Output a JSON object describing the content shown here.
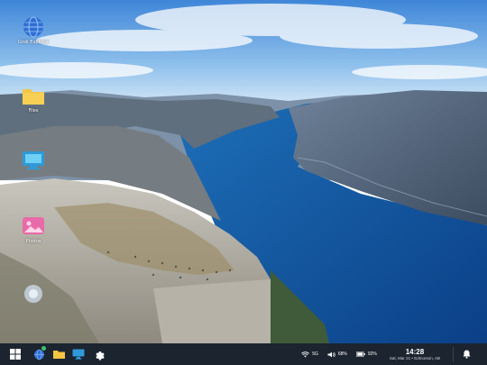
{
  "desktop": {
    "icons": [
      {
        "label": "Grok Explorer",
        "icon": "globe-icon"
      },
      {
        "label": "Files",
        "icon": "folder-icon"
      },
      {
        "label": "",
        "icon": "monitor-icon"
      },
      {
        "label": "Photos",
        "icon": "photos-icon"
      },
      {
        "label": "",
        "icon": "misc-app-icon"
      }
    ]
  },
  "taskbar": {
    "apps": [
      "start-icon",
      "globe-icon",
      "folder-icon",
      "monitor-icon",
      "gear-icon"
    ],
    "tray": {
      "network": "5G",
      "volume": "68%",
      "battery": "92%",
      "time": "14:28",
      "date": "Sat, Mar 21 • Edmonton, AB"
    }
  },
  "colors": {
    "taskbar": "#1c2430",
    "accent": "#2f80ed",
    "folder": "#f5c542",
    "photos": "#e96aa8"
  }
}
